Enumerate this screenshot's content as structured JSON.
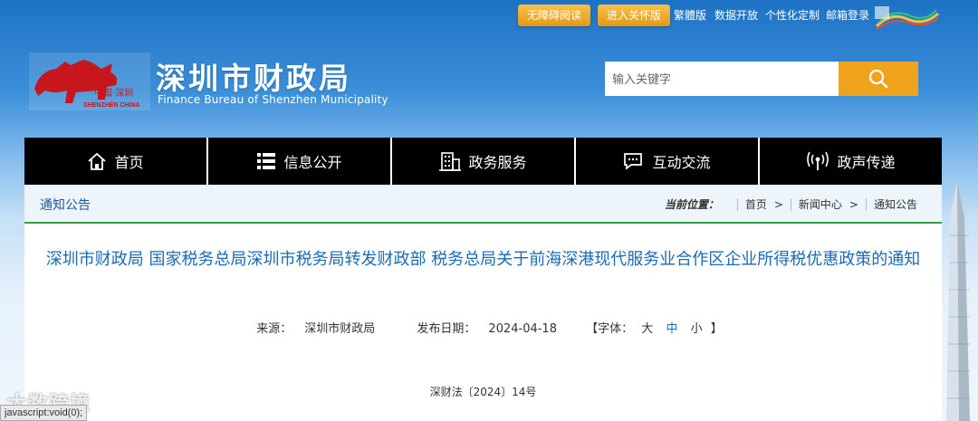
{
  "topbar": {
    "accessibility": "无障碍阅读",
    "elder_mode": "进入关怀版",
    "traditional": "繁體版",
    "open_data": "数据开放",
    "personalize": "个性化定制",
    "mail_login": "邮箱登录"
  },
  "header": {
    "logo_text_cn": "中国·深圳",
    "logo_text_en": "SHENZHEN CHINA",
    "title": "深圳市财政局",
    "subtitle": "Finance Bureau of Shenzhen Municipality",
    "search_placeholder": "输入关键字"
  },
  "nav": {
    "items": [
      {
        "label": "首页",
        "icon": "home-icon"
      },
      {
        "label": "信息公开",
        "icon": "list-icon"
      },
      {
        "label": "政务服务",
        "icon": "building-icon"
      },
      {
        "label": "互动交流",
        "icon": "chat-icon"
      },
      {
        "label": "政声传递",
        "icon": "broadcast-icon"
      }
    ]
  },
  "section": {
    "label": "通知公告"
  },
  "breadcrumb": {
    "prefix": "当前位置：",
    "items": [
      "首页",
      "新闻中心",
      "通知公告"
    ]
  },
  "article": {
    "title": "深圳市财政局 国家税务总局深圳市税务局转发财政部 税务总局关于前海深港现代服务业合作区企业所得税优惠政策的通知",
    "source_label": "来源：",
    "source": "深圳市财政局",
    "date_label": "发布日期：",
    "date": "2024-04-18",
    "font_label": "【字体：",
    "font_large": "大",
    "font_mid": "中",
    "font_small": "小",
    "font_close": "】",
    "doc_number": "深财法〔2024〕14号"
  },
  "statusbar": {
    "text": "javascript:void(0);"
  },
  "watermark": {
    "text": "大数跨境"
  },
  "colors": {
    "accent_orange": "#efa21c",
    "nav_bg": "#000000",
    "title_blue": "#1a6ab6",
    "divider_green": "#3a9a4a"
  }
}
